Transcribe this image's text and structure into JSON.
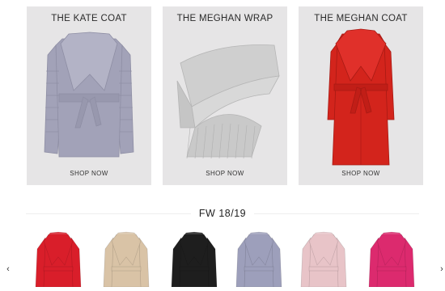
{
  "cards": [
    {
      "title": "THE KATE COAT",
      "cta": "SHOP NOW",
      "color": "#a2a2b8"
    },
    {
      "title": "THE MEGHAN WRAP",
      "cta": "SHOP NOW",
      "color": "#cfcfcf"
    },
    {
      "title": "THE MEGHAN COAT",
      "cta": "SHOP NOW",
      "color": "#d3241c"
    }
  ],
  "carousel": {
    "heading": "FW 18/19",
    "prev_icon": "chevron-left-icon",
    "next_icon": "chevron-right-icon",
    "prev_glyph": "‹",
    "next_glyph": "›",
    "items": [
      {
        "color": "#d91e2a"
      },
      {
        "color": "#d9c3a6"
      },
      {
        "color": "#1e1e1e"
      },
      {
        "color": "#9d9fbb"
      },
      {
        "color": "#e8c4c8"
      },
      {
        "color": "#dc2a6e"
      }
    ]
  }
}
